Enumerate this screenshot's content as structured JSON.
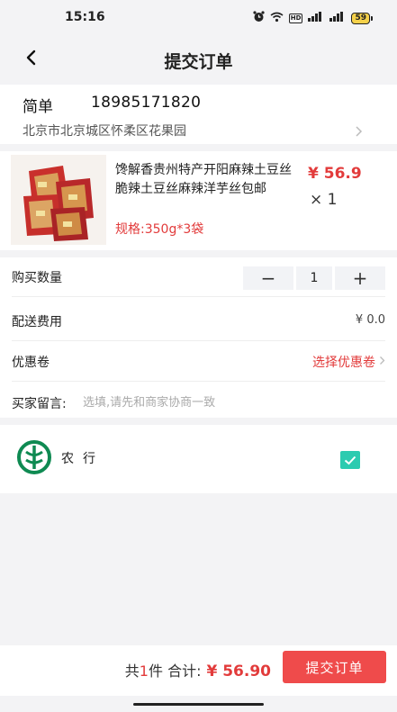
{
  "status_bar": {
    "time": "15:16",
    "battery": "59",
    "signal_1": "5G",
    "signal_2": "5G",
    "hd": "HD"
  },
  "header": {
    "title": "提交订单",
    "back_icon": "chevron-left-icon"
  },
  "address": {
    "name": "简单",
    "phone": "18985171820",
    "line": "北京市北京城区怀柔区花果园"
  },
  "goods": {
    "name": "馋解香贵州特产开阳麻辣土豆丝脆辣土豆丝麻辣洋芋丝包邮",
    "spec": "规格:350g*3袋",
    "price": "¥ 56.9",
    "qty": "× 1"
  },
  "options": {
    "qty_label": "购买数量",
    "qty_value": "1",
    "minus": "−",
    "plus": "+",
    "fee_label": "配送费用",
    "fee_value": "¥ 0.0",
    "coupon_label": "优惠卷",
    "coupon_action": "选择优惠卷",
    "remark_label": "买家留言:",
    "remark_placeholder": "选填,请先和商家协商一致"
  },
  "payment": {
    "bank_name": "农行",
    "selected": true
  },
  "footer": {
    "prefix": "共",
    "count": "1",
    "unit": "件  合计:",
    "total": "¥ 56.90",
    "submit_label": "提交订单"
  },
  "colors": {
    "accent_red": "#ef4b4b",
    "price_red": "#e23b3b",
    "check_teal": "#2ccbb0",
    "bank_green": "#0f8a52"
  }
}
